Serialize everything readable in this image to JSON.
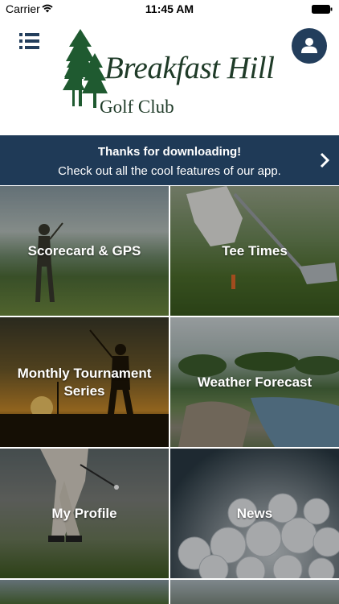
{
  "status_bar": {
    "carrier": "Carrier",
    "time": "11:45 AM"
  },
  "header": {
    "logo_line_1": "Breakfast Hill",
    "logo_line_2": "Golf Club",
    "menu_icon": "menu-list-icon",
    "profile_icon": "user-icon"
  },
  "banner": {
    "title": "Thanks for downloading!",
    "text": "Check out all the cool features of our app."
  },
  "tiles": [
    {
      "label": "Scorecard & GPS"
    },
    {
      "label": "Tee Times"
    },
    {
      "label": "Monthly Tournament Series"
    },
    {
      "label": "Weather Forecast"
    },
    {
      "label": "My Profile"
    },
    {
      "label": "News"
    }
  ],
  "colors": {
    "brand_navy": "#1f3a57",
    "logo_green": "#1f3b28"
  }
}
